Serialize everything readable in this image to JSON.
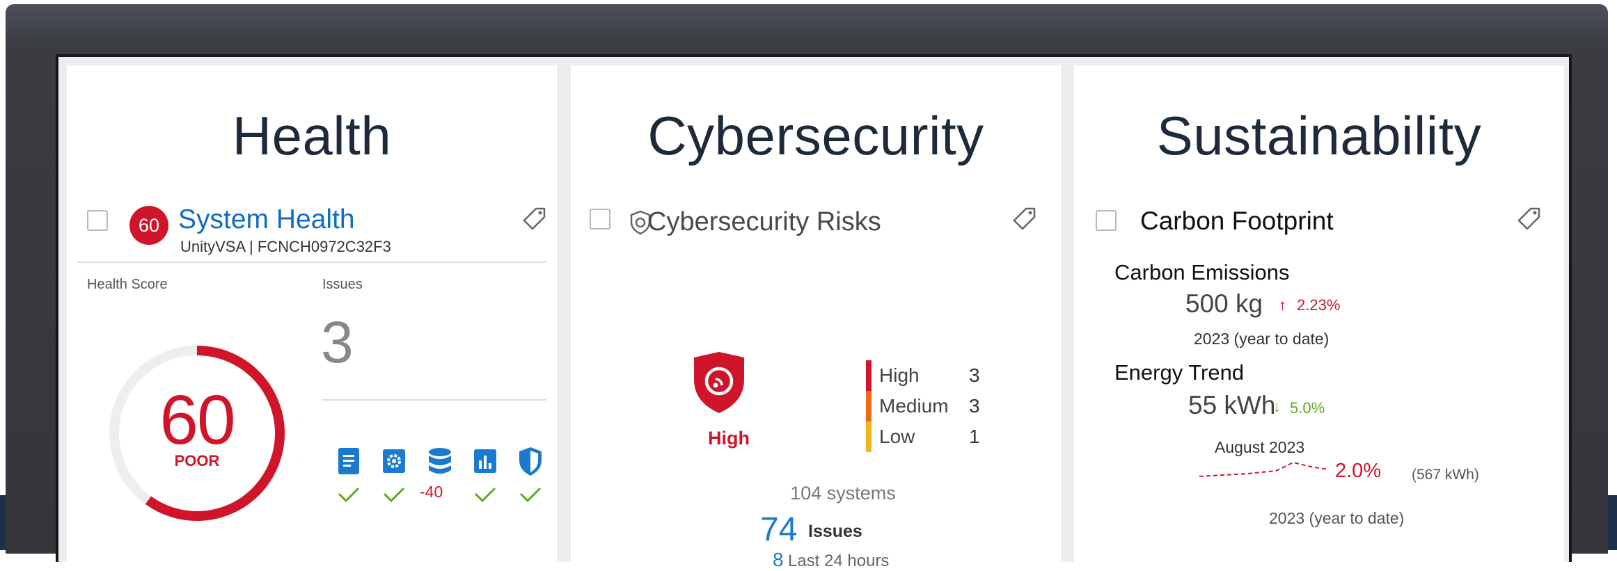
{
  "health": {
    "heading": "Health",
    "card_title": "System Health",
    "card_subtitle": "UnityVSA | FCNCH0972C32F3",
    "score_badge": "60",
    "health_score_label": "Health Score",
    "issues_label": "Issues",
    "issues_count": "3",
    "gauge": {
      "score": 60,
      "max": 100,
      "value_text": "60",
      "rating": "POOR",
      "color": "#d0152a"
    },
    "categories": [
      {
        "icon": "document-icon",
        "status": "ok"
      },
      {
        "icon": "gear-icon",
        "status": "ok"
      },
      {
        "icon": "database-icon",
        "status": "-40"
      },
      {
        "icon": "bar-chart-icon",
        "status": "ok"
      },
      {
        "icon": "shield-icon",
        "status": "ok"
      }
    ]
  },
  "cybersecurity": {
    "heading": "Cybersecurity",
    "card_title": "Cybersecurity Risks",
    "overall_risk": "High",
    "risks": [
      {
        "level": "High",
        "count": "3",
        "color": "#d0152a"
      },
      {
        "level": "Medium",
        "count": "3",
        "color": "#ec6a1c"
      },
      {
        "level": "Low",
        "count": "1",
        "color": "#f2b61a"
      }
    ],
    "systems": "104 systems",
    "issues_count": "74",
    "issues_label": "Issues",
    "recent_count": "8",
    "recent_label": "Last 24 hours"
  },
  "sustainability": {
    "heading": "Sustainability",
    "card_title": "Carbon Footprint",
    "emissions": {
      "label": "Carbon Emissions",
      "value": "500 kg",
      "change": "2.23%",
      "direction": "up",
      "period": "2023 (year to date)"
    },
    "energy": {
      "label": "Energy Trend",
      "value": "55 kWh",
      "change": "5.0%",
      "direction": "down",
      "month": "August 2023",
      "trend_pct": "2.0%",
      "trend_kwh": "(567 kWh)",
      "period": "2023 (year to date)"
    }
  },
  "colors": {
    "accent_blue": "#0e6cc4",
    "alert_red": "#d0152a",
    "ok_green": "#5ea822"
  }
}
